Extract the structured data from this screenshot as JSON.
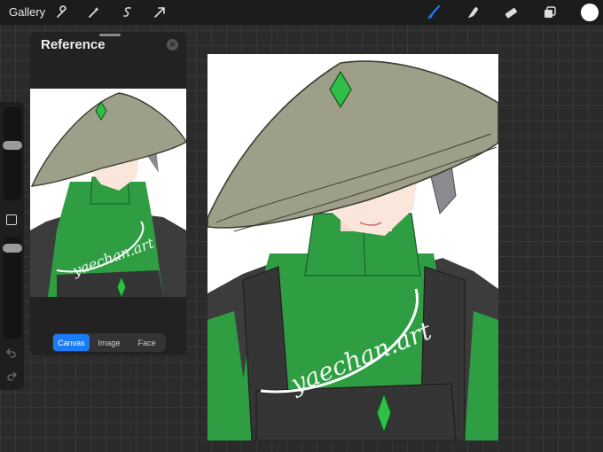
{
  "topbar": {
    "gallery_label": "Gallery",
    "left_tools": [
      "wrench-icon",
      "magic-wand-icon",
      "selection-icon",
      "transform-arrow-icon"
    ],
    "right_tools": [
      "brush-icon",
      "smudge-icon",
      "eraser-icon",
      "layers-icon"
    ],
    "accent_color": "#1a7cf5",
    "current_color": "#ffffff"
  },
  "sidebar": {
    "brush_size_level": 0.85,
    "opacity_level": 0.95
  },
  "reference": {
    "title": "Reference",
    "tabs": [
      {
        "label": "Canvas",
        "active": true
      },
      {
        "label": "Image",
        "active": false
      },
      {
        "label": "Face",
        "active": false
      }
    ]
  },
  "artwork": {
    "watermark": "yaechan.art",
    "hat_color": "#9e9f88",
    "jacket_color": "#2f9e43",
    "vest_color": "#3c3c3c",
    "eye_color": "#b6e04a",
    "hair_color": "#8c8a90"
  }
}
